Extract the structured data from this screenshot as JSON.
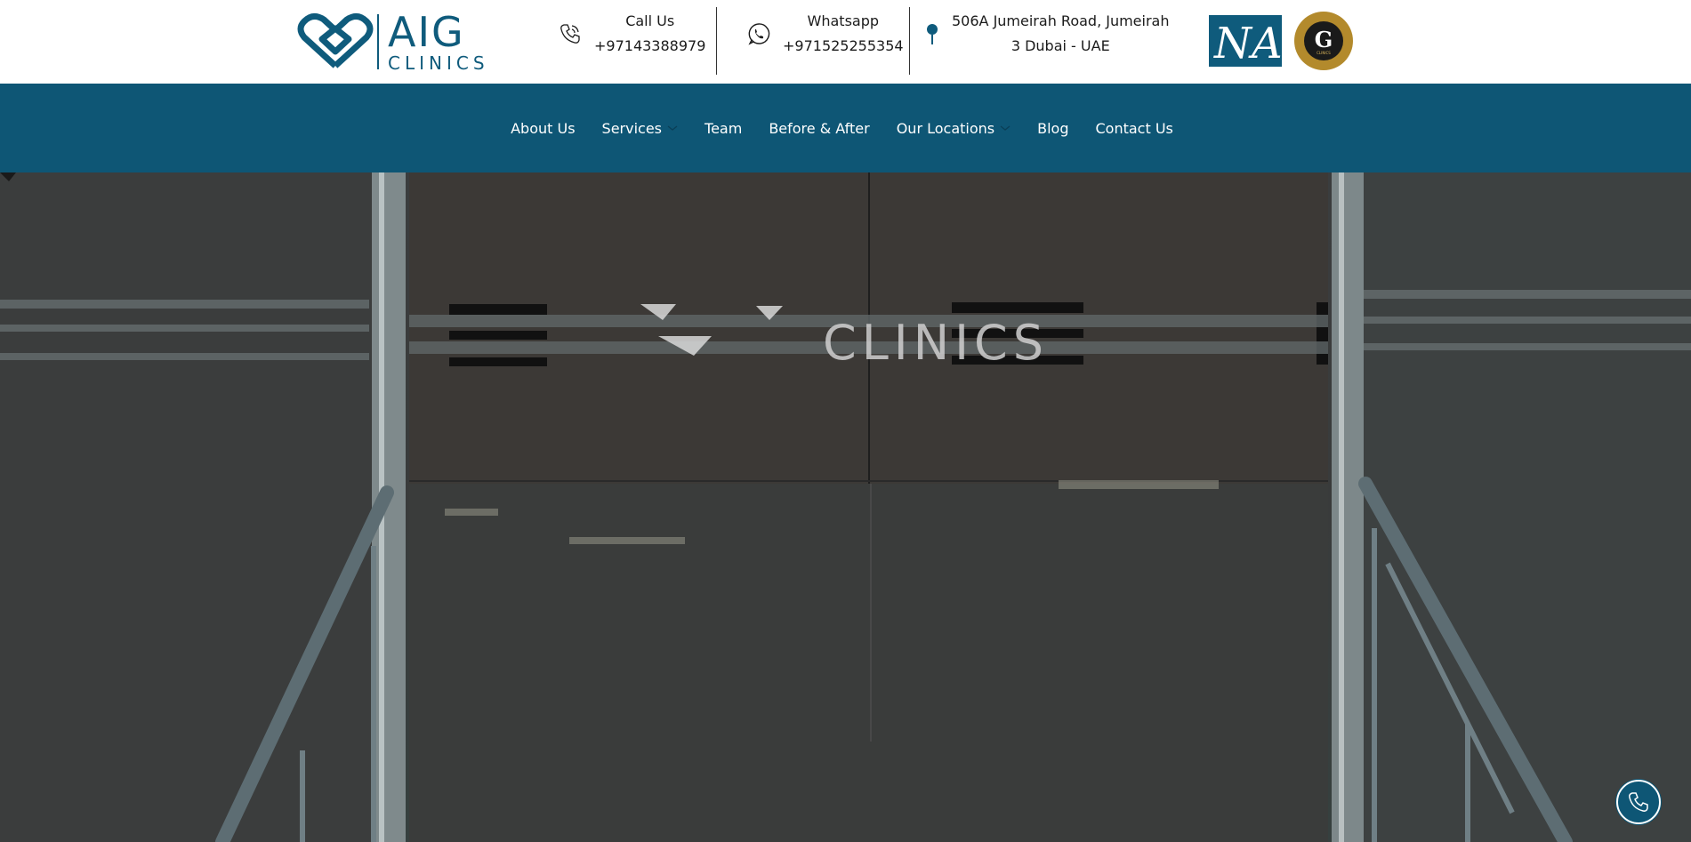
{
  "header": {
    "logo": {
      "wordmark": "AIG",
      "sub": "CLINICS"
    },
    "call": {
      "label": "Call Us",
      "value": "+97143388979"
    },
    "whatsapp": {
      "label": "Whatsapp",
      "value": "+971525255354"
    },
    "address": {
      "line1": "506A Jumeirah Road, Jumeirah",
      "line2": "3 Dubai - UAE"
    },
    "partner_badges": [
      {
        "name": "na-logo",
        "text": "NA"
      },
      {
        "name": "g-clinics-logo",
        "text": "G",
        "sub": "CLINICS"
      }
    ]
  },
  "nav": {
    "items": [
      {
        "label": "About Us",
        "has_dropdown": false
      },
      {
        "label": "Services",
        "has_dropdown": true
      },
      {
        "label": "Team",
        "has_dropdown": false
      },
      {
        "label": "Before & After",
        "has_dropdown": false
      },
      {
        "label": "Our Locations",
        "has_dropdown": true
      },
      {
        "label": "Blog",
        "has_dropdown": false
      },
      {
        "label": "Contact Us",
        "has_dropdown": false
      }
    ]
  },
  "hero": {
    "glass_sign_text": "CLINICS"
  },
  "floating_call_button": {
    "icon": "phone-icon"
  },
  "colors": {
    "brand": "#0f5b7c",
    "nav_bg": "#0e5675",
    "gold": "#b38a2c",
    "header_bg": "#ffffff"
  }
}
